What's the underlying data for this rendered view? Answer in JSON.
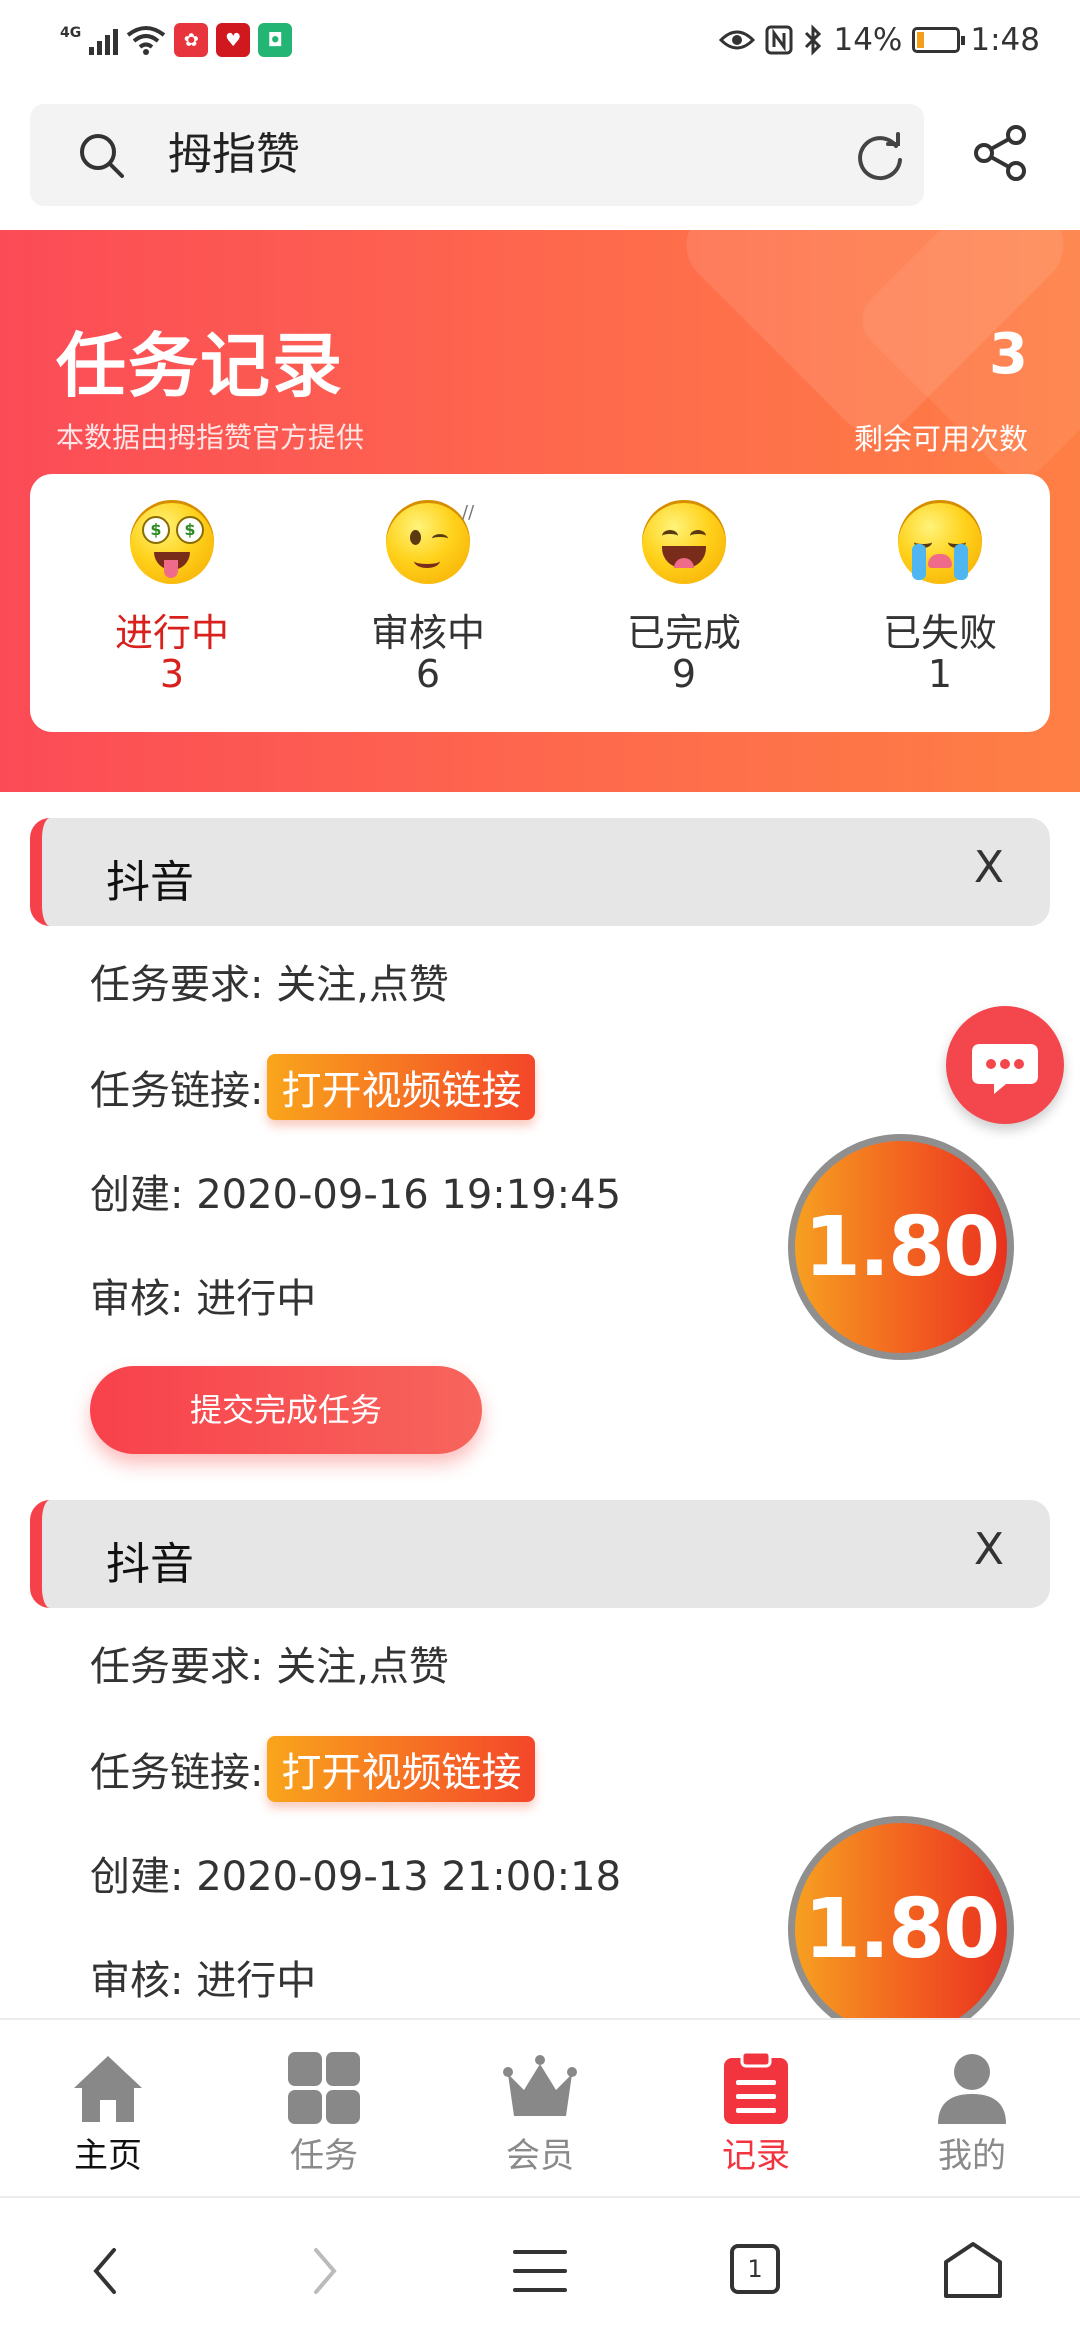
{
  "status_bar": {
    "network": "4G",
    "battery_percent": "14%",
    "time": "1:48"
  },
  "search": {
    "query": "拇指赞"
  },
  "header": {
    "title": "任务记录",
    "subtitle": "本数据由拇指赞官方提供",
    "remaining_count": "3",
    "remaining_label": "剩余可用次数"
  },
  "stats": [
    {
      "label": "进行中",
      "count": "3",
      "icon": "money-eyes-emoji-icon",
      "active": true
    },
    {
      "label": "审核中",
      "count": "6",
      "icon": "winking-emoji-icon",
      "active": false
    },
    {
      "label": "已完成",
      "count": "9",
      "icon": "grinning-emoji-icon",
      "active": false
    },
    {
      "label": "已失败",
      "count": "1",
      "icon": "crying-emoji-icon",
      "active": false
    }
  ],
  "tasks": [
    {
      "platform": "抖音",
      "close_label": "X",
      "requirement_label": "任务要求:",
      "requirement": "关注,点赞",
      "link_label": "任务链接:",
      "link_button": "打开视频链接",
      "created_label": "创建:",
      "created": "2020-09-16 19:19:45",
      "review_label": "审核:",
      "review": "进行中",
      "reward": "1.80",
      "submit_button": "提交完成任务"
    },
    {
      "platform": "抖音",
      "close_label": "X",
      "requirement_label": "任务要求:",
      "requirement": "关注,点赞",
      "link_label": "任务链接:",
      "link_button": "打开视频链接",
      "created_label": "创建:",
      "created": "2020-09-13 21:00:18",
      "review_label": "审核:",
      "review": "进行中",
      "reward": "1.80"
    }
  ],
  "bottom_nav": [
    {
      "label": "主页",
      "icon": "home-icon"
    },
    {
      "label": "任务",
      "icon": "grid-icon"
    },
    {
      "label": "会员",
      "icon": "crown-icon"
    },
    {
      "label": "记录",
      "icon": "clipboard-icon",
      "active": true
    },
    {
      "label": "我的",
      "icon": "user-icon"
    }
  ],
  "system_nav": {
    "tab_count": "1"
  },
  "colors": {
    "accent": "#f2343f",
    "header_gradient_start": "#fb4b57",
    "header_gradient_end": "#fe7f45",
    "reward_orange": "#f6a021"
  }
}
